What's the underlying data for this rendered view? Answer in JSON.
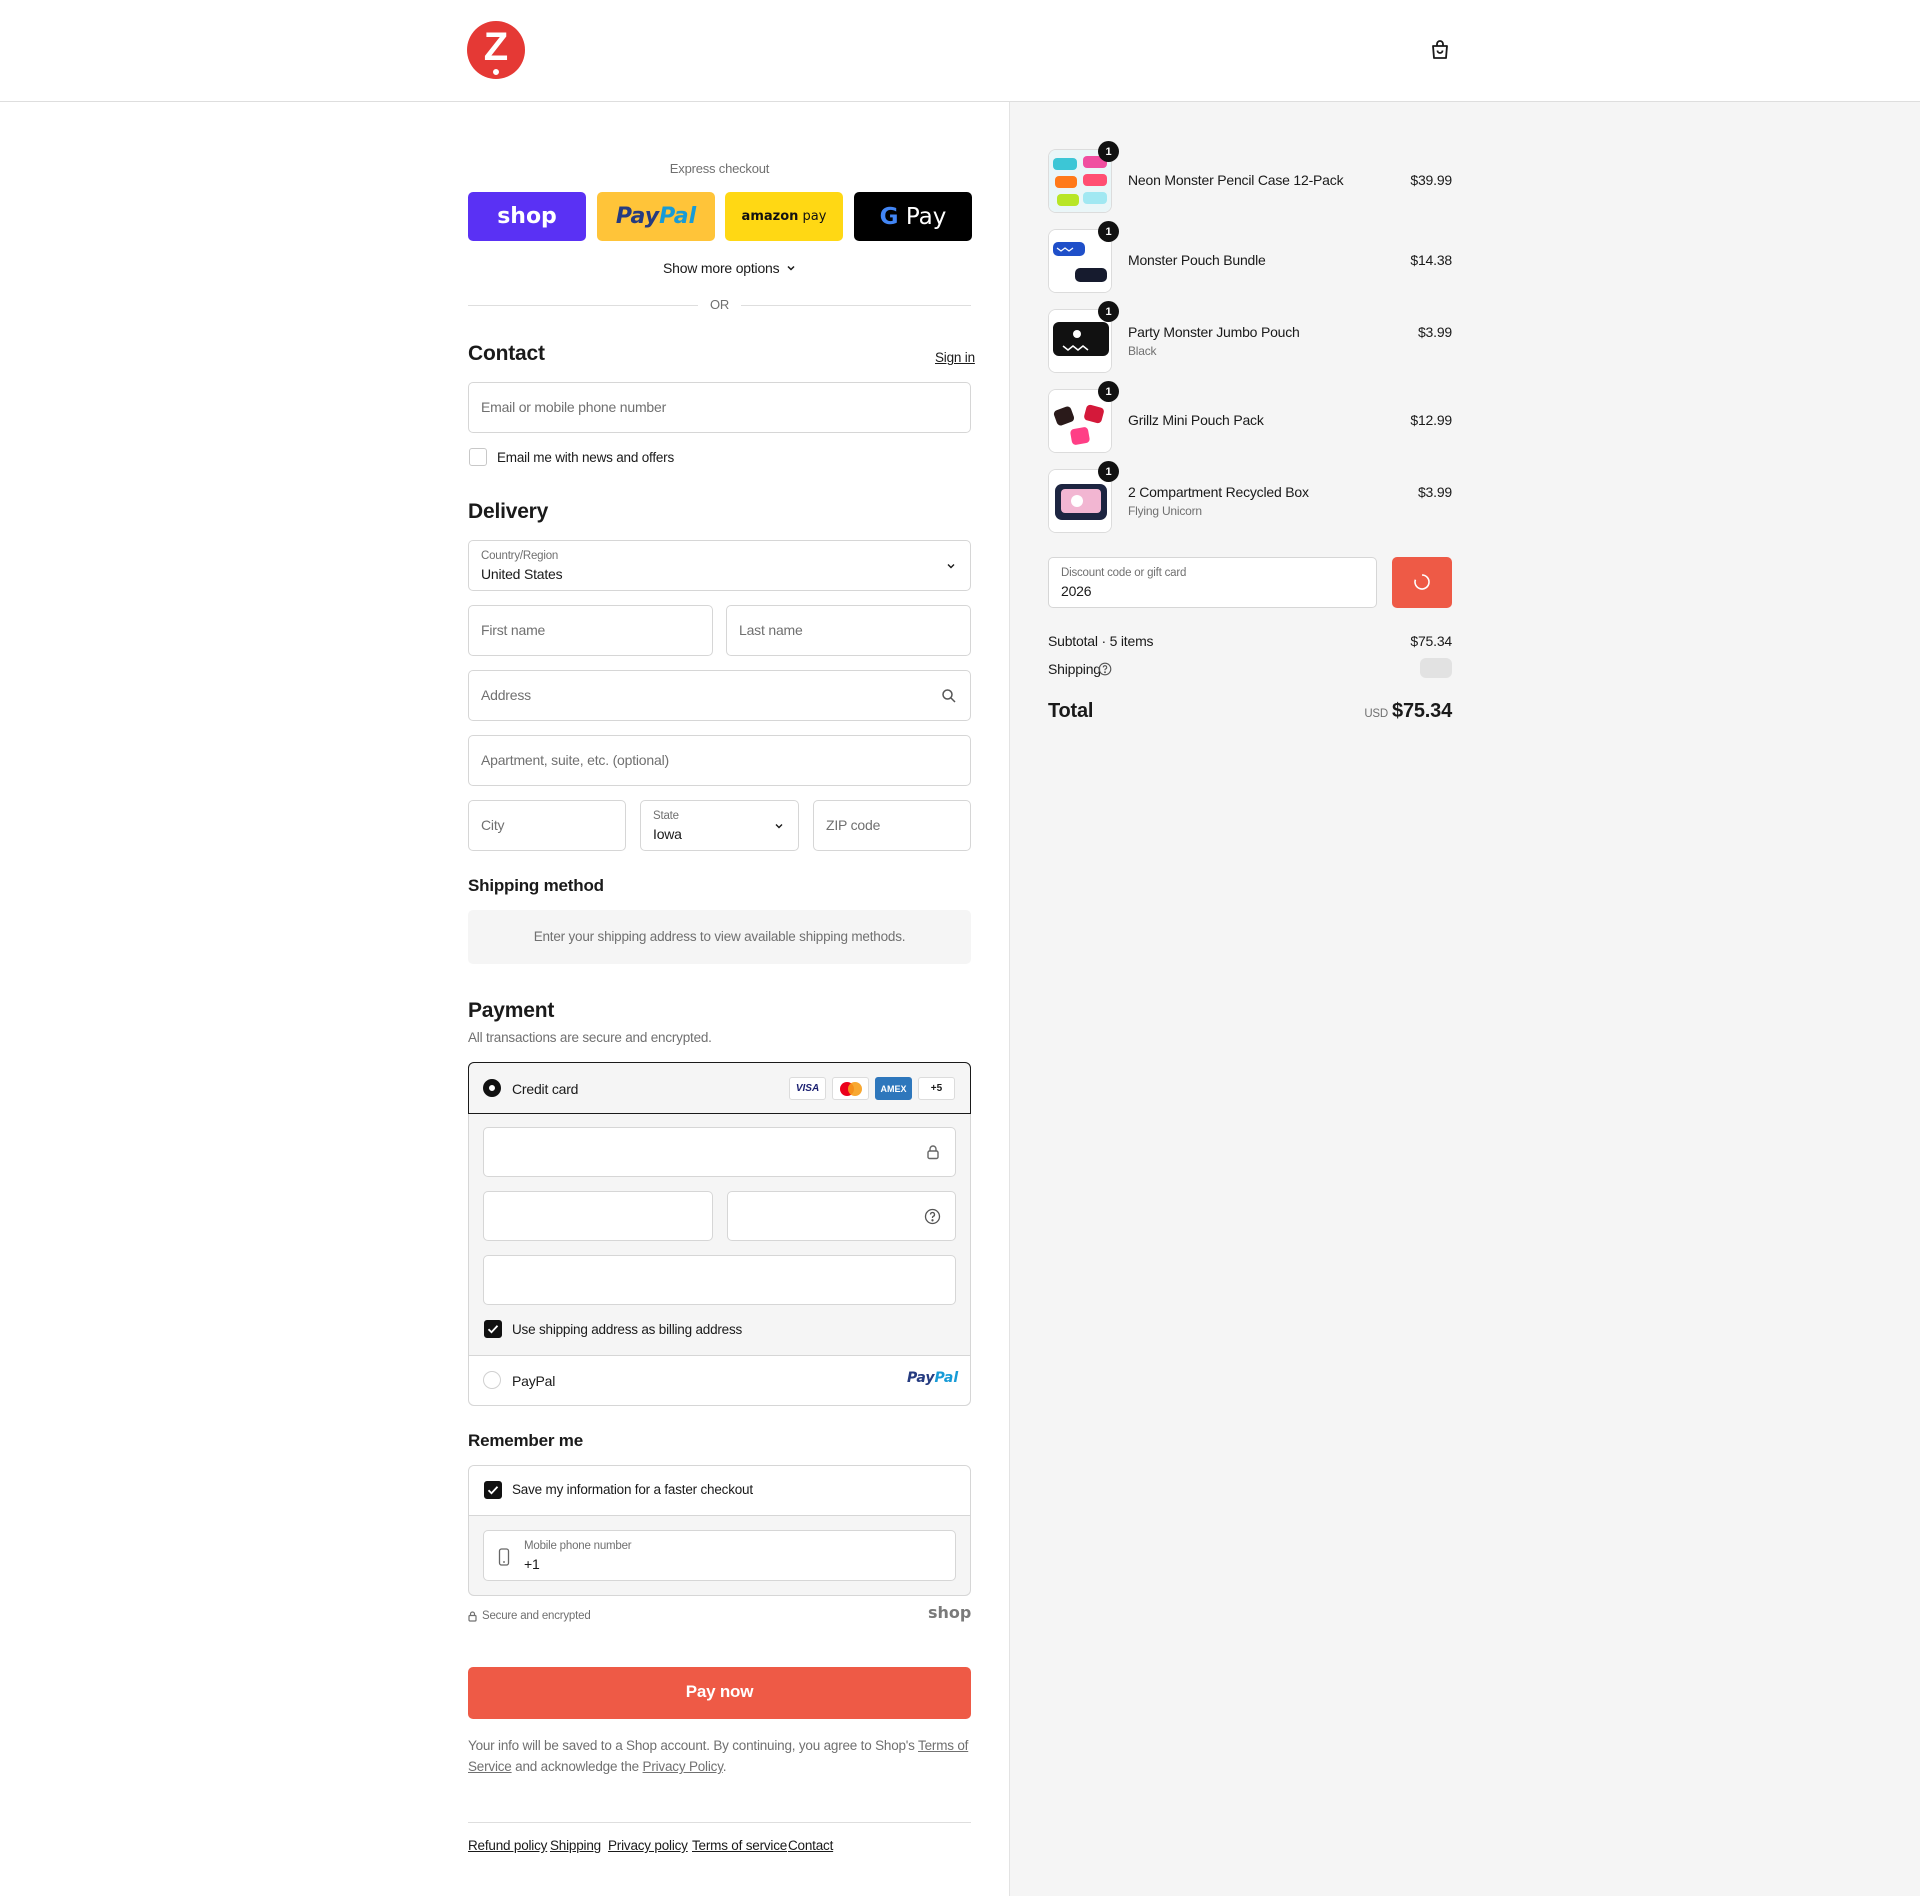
{
  "colors": {
    "accent": "#ee5a46",
    "shop_purple": "#5a31f4",
    "paypal_yellow": "#ffc439",
    "amazon_yellow": "#ffd814",
    "border": "#d6d6d6"
  },
  "header": {
    "logo_text": "Z",
    "logo_icon": "z-logo-icon",
    "cart_icon": "shopping-bag-icon"
  },
  "express": {
    "title": "Express checkout",
    "buttons": {
      "shop": "shop",
      "paypal_a": "Pay",
      "paypal_b": "Pal",
      "amazon_a": "amazon",
      "amazon_b": "pay",
      "gpay_g": "G",
      "gpay": "Pay"
    },
    "show_more": "Show more options",
    "or": "OR"
  },
  "contact": {
    "title": "Contact",
    "sign_in": "Sign in",
    "email_placeholder": "Email or mobile phone number",
    "news_label": "Email me with news and offers"
  },
  "delivery": {
    "title": "Delivery",
    "country_label": "Country/Region",
    "country_value": "United States",
    "first_name": "First name",
    "last_name": "Last name",
    "address": "Address",
    "apartment": "Apartment, suite, etc. (optional)",
    "city": "City",
    "state_label": "State",
    "state_value": "Iowa",
    "zip": "ZIP code"
  },
  "shipping_method": {
    "title": "Shipping method",
    "message": "Enter your shipping address to view available shipping methods."
  },
  "payment": {
    "title": "Payment",
    "subtitle": "All transactions are secure and encrypted.",
    "credit_card": "Credit card",
    "cards": {
      "visa": "VISA",
      "amex": "AMEX",
      "more": "+5"
    },
    "billing_label": "Use shipping address as billing address",
    "paypal_label": "PayPal",
    "paypal_logo_a": "Pay",
    "paypal_logo_b": "Pal"
  },
  "remember": {
    "title": "Remember me",
    "save_label": "Save my information for a faster checkout",
    "phone_label": "Mobile phone number",
    "phone_value": "+1",
    "secure": "Secure and encrypted",
    "shop_logo": "shop"
  },
  "pay_now": "Pay now",
  "legal": {
    "before": "Your info will be saved to a Shop account. By continuing, you agree to Shop's ",
    "terms": "Terms of Service",
    "mid": " and acknowledge the ",
    "privacy": "Privacy Policy",
    "after": "."
  },
  "footer_links": [
    "Refund policy",
    "Shipping",
    "Privacy policy",
    "Terms of service",
    "Contact"
  ],
  "summary": {
    "items": [
      {
        "name": "Neon Monster Pencil Case 12-Pack",
        "variant": "",
        "price": "$39.99",
        "qty": "1"
      },
      {
        "name": "Monster Pouch Bundle",
        "variant": "",
        "price": "$14.38",
        "qty": "1"
      },
      {
        "name": "Party Monster Jumbo Pouch",
        "variant": "Black",
        "price": "$3.99",
        "qty": "1"
      },
      {
        "name": "Grillz Mini Pouch Pack",
        "variant": "",
        "price": "$12.99",
        "qty": "1"
      },
      {
        "name": "2 Compartment Recycled Box",
        "variant": "Flying Unicorn",
        "price": "$3.99",
        "qty": "1"
      }
    ],
    "discount_label": "Discount code or gift card",
    "discount_value": "2026",
    "subtotal_label": "Subtotal · 5 items",
    "subtotal_value": "$75.34",
    "shipping_label": "Shipping",
    "total_label": "Total",
    "currency": "USD",
    "total_value": "$75.34"
  }
}
